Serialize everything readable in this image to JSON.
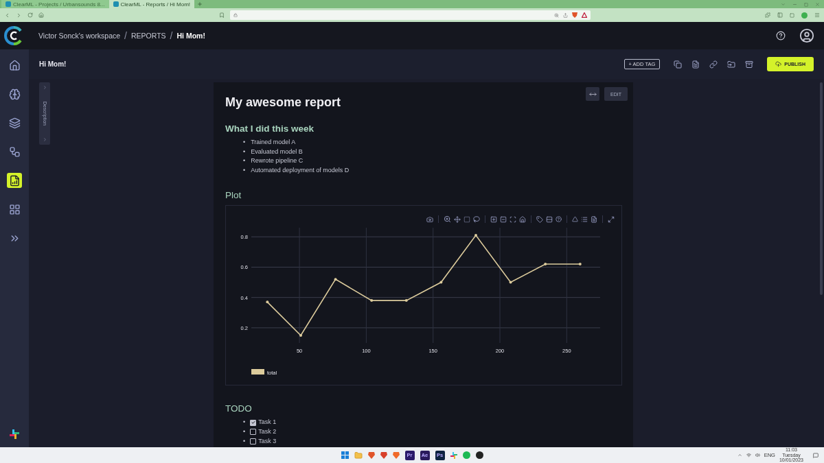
{
  "browser": {
    "tabs": [
      {
        "title": "ClearML - Projects / Urbansounds 8...",
        "selected": false
      },
      {
        "title": "ClearML - Reports / Hi Mom!",
        "selected": true
      }
    ]
  },
  "header": {
    "breadcrumb": [
      "Victor Sonck's workspace",
      "REPORTS",
      "Hi Mom!"
    ],
    "separators": [
      "/",
      "/"
    ]
  },
  "sidebar": {
    "items": [
      {
        "kind": "home",
        "selected": false
      },
      {
        "kind": "brain",
        "selected": false
      },
      {
        "kind": "layers",
        "selected": false
      },
      {
        "kind": "pipelines",
        "selected": false
      },
      {
        "kind": "reports",
        "selected": true
      },
      {
        "kind": "table",
        "selected": false
      },
      {
        "kind": "deploy",
        "selected": false
      }
    ]
  },
  "toolbar": {
    "title": "Hi Mom!",
    "add_tag": "+ ADD TAG",
    "publish": "PUBLISH"
  },
  "description_tab": {
    "label": "Description"
  },
  "report": {
    "edit": "EDIT",
    "title": "My awesome report",
    "sections": [
      {
        "kind": "list",
        "heading": "What I did this week",
        "bullet": "•",
        "items": [
          "Trained model A",
          "Evaluated model B",
          "Rewrote pipeline C",
          "Automated deployment of models D"
        ]
      },
      {
        "kind": "plot",
        "heading": "Plot",
        "chart_data": {
          "type": "line",
          "x": [
            26,
            51,
            77,
            104,
            130,
            156,
            182,
            208,
            234,
            260
          ],
          "series": [
            {
              "name": "total",
              "color": "#dccb9c",
              "values": [
                0.37,
                0.15,
                0.52,
                0.38,
                0.38,
                0.5,
                0.81,
                0.5,
                0.62,
                0.62
              ]
            }
          ],
          "xlim": [
            14,
            275
          ],
          "ylim": [
            0.1,
            0.86
          ],
          "xticks": [
            50,
            100,
            150,
            200,
            250
          ],
          "yticks": [
            0.2,
            0.4,
            0.6,
            0.8
          ],
          "grid": true
        }
      },
      {
        "kind": "todo",
        "heading": "TODO",
        "bullet": "•",
        "tasks": [
          {
            "label": "Task 1",
            "checked": true
          },
          {
            "label": "Task 2",
            "checked": false
          },
          {
            "label": "Task 3",
            "checked": false
          }
        ]
      }
    ]
  },
  "taskbar": {
    "apps": [
      {
        "kind": "windows"
      },
      {
        "kind": "folder"
      },
      {
        "kind": "lion",
        "color": "#e0542a"
      },
      {
        "kind": "lion",
        "color": "#d8402a"
      },
      {
        "kind": "lion",
        "color": "#f06a2a"
      },
      {
        "kind": "letter",
        "label": "Pr",
        "color": "#2b1b6a"
      },
      {
        "kind": "letter",
        "label": "Ae",
        "color": "#2a1a5c"
      },
      {
        "kind": "letter",
        "label": "Ps",
        "color": "#0d2240"
      },
      {
        "kind": "slack"
      },
      {
        "kind": "spotify"
      },
      {
        "kind": "dark"
      }
    ],
    "language": "ENG",
    "time": "11:03",
    "day": "Tuesday",
    "date": "10/01/2023"
  }
}
